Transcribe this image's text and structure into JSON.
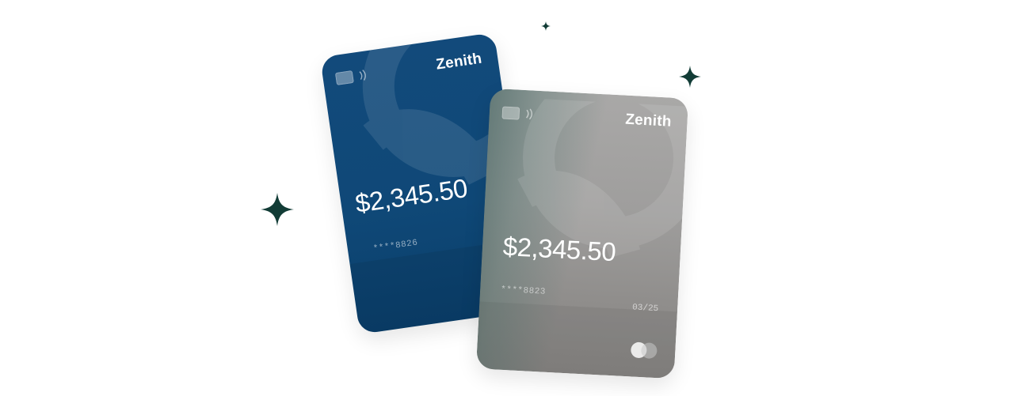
{
  "cards": [
    {
      "brand": "Zenith",
      "balance": "$2,345.50",
      "number": "****8826",
      "color": "#0f4877",
      "icons": [
        "chip-icon",
        "contactless-icon"
      ]
    },
    {
      "brand": "Zenith",
      "balance": "$2,345.50",
      "number": "****8823",
      "expiry": "03/25",
      "color": "#9f9e9d",
      "icons": [
        "chip-icon",
        "contactless-icon",
        "card-network-logo"
      ]
    }
  ],
  "decorations": {
    "sparkle_color": "#123c36",
    "icons": [
      "sparkle-icon"
    ]
  }
}
